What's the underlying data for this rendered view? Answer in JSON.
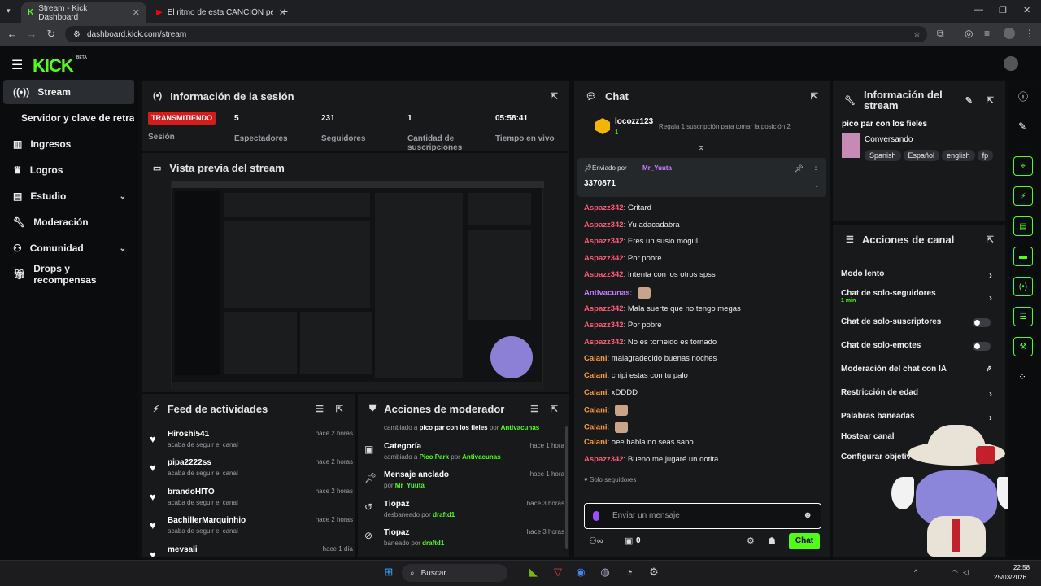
{
  "browser": {
    "tabs": [
      {
        "label": "Stream - Kick Dashboard"
      },
      {
        "label": "El ritmo de esta CANCIÓN peg..."
      }
    ],
    "url": "dashboard.kick.com/stream"
  },
  "brand": {
    "logo": "KICK",
    "beta": "BETA",
    "accent": "#53fc18"
  },
  "sidebar": {
    "items": [
      {
        "label": "Stream",
        "icon": "radio-icon"
      },
      {
        "label": "Servidor y clave de retransm"
      },
      {
        "label": "Ingresos",
        "icon": "chart-icon"
      },
      {
        "label": "Logros",
        "icon": "trophy-icon"
      },
      {
        "label": "Estudio",
        "icon": "layout-icon"
      },
      {
        "label": "Moderación",
        "icon": "wrench-icon"
      },
      {
        "label": "Comunidad",
        "icon": "community-icon"
      },
      {
        "label": "Drops y recompensas",
        "icon": "gift-icon"
      }
    ]
  },
  "session": {
    "title": "Información de la sesión",
    "live_badge": "TRANSMITIENDO",
    "session_label": "Sesión",
    "stats": [
      {
        "value": "5",
        "label": "Espectadores"
      },
      {
        "value": "231",
        "label": "Seguidores"
      },
      {
        "value": "1",
        "label": "Cantidad de suscripciones"
      },
      {
        "value": "05:58:41",
        "label": "Tiempo en vivo"
      }
    ]
  },
  "preview": {
    "title": "Vista previa del stream"
  },
  "feed": {
    "title": "Feed de actividades",
    "items": [
      {
        "name": "Hiroshi541",
        "sub": "acaba de seguir el canal",
        "time": "hace 2 horas"
      },
      {
        "name": "pipa2222ss",
        "sub": "acaba de seguir el canal",
        "time": "hace 2 horas"
      },
      {
        "name": "brandoHITO",
        "sub": "acaba de seguir el canal",
        "time": "hace 2 horas"
      },
      {
        "name": "BachillerMarquinhio",
        "sub": "acaba de seguir el canal",
        "time": "hace 2 horas"
      },
      {
        "name": "mevsali",
        "sub": "",
        "time": "hace 1 día"
      }
    ]
  },
  "modactions": {
    "title": "Acciones de moderador",
    "top_partial": {
      "a": "cambiado a ",
      "b": "pico par con los fieles",
      "c": " por ",
      "d": "Antivacunas"
    },
    "items": [
      {
        "title": "Categoría",
        "pre": "cambiado a ",
        "hl": "Pico Park",
        "mid": " por ",
        "hl2": "Antivacunas",
        "time": "hace 1 hora",
        "icon": "category-icon"
      },
      {
        "title": "Mensaje anclado",
        "pre": "por ",
        "hl": "Mr_Yuuta",
        "mid": "",
        "hl2": "",
        "time": "hace 1 hora",
        "icon": "pin-icon"
      },
      {
        "title": "Tiopaz",
        "pre": "desbaneado por ",
        "hl": "draftd1",
        "mid": "",
        "hl2": "",
        "time": "hace 3 horas",
        "icon": "undo-icon"
      },
      {
        "title": "Tiopaz",
        "pre": "baneado por ",
        "hl": "draftd1",
        "mid": "",
        "hl2": "",
        "time": "hace 3 horas",
        "icon": "ban-icon"
      }
    ]
  },
  "chat": {
    "title": "Chat",
    "top_gifter": {
      "name": "locozz123",
      "count": "1",
      "promo": "Regala 1 suscripción para tomar la posición 2"
    },
    "pinned": {
      "label": "Enviado por",
      "by": "Mr_Yuuta",
      "text": "3370871"
    },
    "messages": [
      {
        "user": "Aspazz342",
        "text": "Gritard",
        "color": "red"
      },
      {
        "user": "Aspazz342",
        "text": "Yu adacadabra",
        "color": "red"
      },
      {
        "user": "Aspazz342",
        "text": "Eres un susio mogul",
        "color": "red"
      },
      {
        "user": "Aspazz342",
        "text": "Por pobre",
        "color": "red"
      },
      {
        "user": "Aspazz342",
        "text": "Intenta con los otros spss",
        "color": "red"
      },
      {
        "user": "Antivacunas",
        "text": "",
        "color": "purple"
      },
      {
        "user": "Aspazz342",
        "text": "Mala suerte que no tengo megas",
        "color": "red"
      },
      {
        "user": "Aspazz342",
        "text": "Por pobre",
        "color": "red"
      },
      {
        "user": "Aspazz342",
        "text": "No es torneido es tornado",
        "color": "red"
      },
      {
        "user": "Calani",
        "text": "malagradecido buenas noches",
        "color": "orange"
      },
      {
        "user": "Calani",
        "text": "chipi estas con tu palo",
        "color": "orange"
      },
      {
        "user": "Calani",
        "text": "xDDDD",
        "color": "orange"
      },
      {
        "user": "Calani",
        "text": "",
        "color": "orange"
      },
      {
        "user": "Calani",
        "text": "",
        "color": "orange"
      },
      {
        "user": "Calani",
        "text": "oee habla no seas sano",
        "color": "orange"
      },
      {
        "user": "Aspazz342",
        "text": "Bueno me jugaré un dotita",
        "color": "red"
      }
    ],
    "followers_only": "Solo seguidores",
    "input_placeholder": "Enviar un mensaje",
    "footer_count": "0",
    "send_label": "Chat"
  },
  "stream_info": {
    "title": "Información del stream",
    "stream_title": "pico par con los fieles",
    "category": "Conversando",
    "tags": [
      "Spanish",
      "Español",
      "english",
      "fp"
    ]
  },
  "channel_actions": {
    "title": "Acciones de canal",
    "items": [
      {
        "label": "Modo lento",
        "control": "chevron"
      },
      {
        "label": "Chat de solo-seguidores",
        "sub": "1 min",
        "control": "chevron"
      },
      {
        "label": "Chat de solo-suscriptores",
        "control": "toggle"
      },
      {
        "label": "Chat de solo-emotes",
        "control": "toggle"
      },
      {
        "label": "Moderación del chat con IA",
        "control": "external"
      },
      {
        "label": "Restricción de edad",
        "control": "chevron"
      },
      {
        "label": "Palabras baneadas",
        "control": "chevron"
      },
      {
        "label": "Hostear canal",
        "control": "none"
      },
      {
        "label": "Configurar objetivos",
        "control": "none"
      }
    ]
  },
  "taskbar": {
    "search": "Buscar",
    "time": "22:58",
    "date": "25/03/2026"
  }
}
